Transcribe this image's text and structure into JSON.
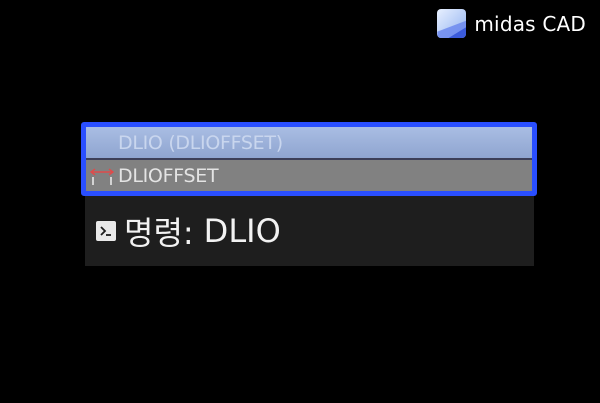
{
  "brand": {
    "name": "midas CAD",
    "logo_icon": "midas-logo-icon"
  },
  "autocomplete": {
    "items": [
      {
        "label": "DLIO (DLIOFFSET)",
        "selected": true
      },
      {
        "label": "DLIOFFSET",
        "icon": "dimension-offset-icon",
        "selected": false
      }
    ],
    "border_color": "#2a4fff"
  },
  "command_line": {
    "prompt_icon": "command-prompt-icon",
    "label": "명령:",
    "value": "DLIO"
  }
}
